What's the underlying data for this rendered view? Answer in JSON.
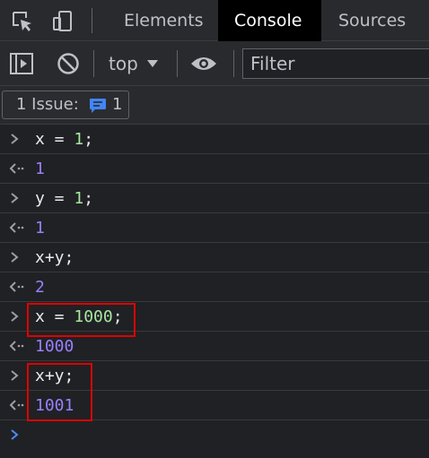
{
  "tabs": {
    "elements": "Elements",
    "console": "Console",
    "sources": "Sources"
  },
  "toolbar": {
    "context": "top",
    "filter_placeholder": "Filter"
  },
  "issues": {
    "label": "1 Issue:",
    "count": "1"
  },
  "console": {
    "entries": [
      {
        "input": [
          {
            "t": "ident",
            "v": "x = "
          },
          {
            "t": "num",
            "v": "1"
          },
          {
            "t": "ident",
            "v": ";"
          }
        ],
        "output": "1"
      },
      {
        "input": [
          {
            "t": "ident",
            "v": "y = "
          },
          {
            "t": "num",
            "v": "1"
          },
          {
            "t": "ident",
            "v": ";"
          }
        ],
        "output": "1"
      },
      {
        "input": [
          {
            "t": "ident",
            "v": "x+y;"
          }
        ],
        "output": "2"
      },
      {
        "input": [
          {
            "t": "ident",
            "v": "x = "
          },
          {
            "t": "num",
            "v": "1000"
          },
          {
            "t": "ident",
            "v": ";"
          }
        ],
        "output": "1000"
      },
      {
        "input": [
          {
            "t": "ident",
            "v": "x+y;"
          }
        ],
        "output": "1001"
      }
    ]
  },
  "colors": {
    "number_literal": "#a8e6a0",
    "result_value": "#9980ff",
    "highlight_box": "#e00000",
    "active_tab_bg": "#000000",
    "issue_icon": "#4285f4"
  },
  "icons": {
    "inspect": "inspect-element-icon",
    "device": "device-toolbar-icon",
    "sidebar": "sidebar-toggle-icon",
    "clear": "clear-console-icon",
    "eye": "live-expression-icon",
    "issue": "message-icon",
    "input_prompt": "chevron-right-icon",
    "result": "return-arrow-icon"
  }
}
